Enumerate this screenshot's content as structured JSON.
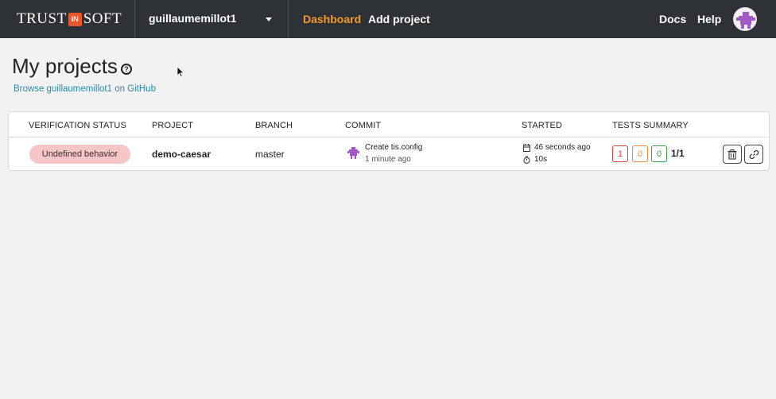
{
  "header": {
    "logo_left": "TRUST",
    "logo_mid": "IN",
    "logo_right": "SOFT",
    "user": "guillaumemillot1",
    "nav": [
      {
        "label": "Dashboard"
      },
      {
        "label": "Add project"
      }
    ],
    "docs": "Docs",
    "help": "Help"
  },
  "page": {
    "title": "My projects",
    "help_glyph": "?",
    "github_link": "Browse guillaumemillot1 on GitHub"
  },
  "table": {
    "columns": [
      "VERIFICATION STATUS",
      "PROJECT",
      "BRANCH",
      "COMMIT",
      "STARTED",
      "TESTS SUMMARY"
    ],
    "rows": [
      {
        "status": "Undefined behavior",
        "project": "demo-caesar",
        "branch": "master",
        "commit_message": "Create tis.config",
        "commit_time": "1 minute ago",
        "started": "46 seconds ago",
        "duration": "10s",
        "tests": {
          "failed": "1",
          "warning": "0",
          "passed": "0",
          "ratio": "1/1"
        }
      }
    ]
  },
  "colors": {
    "topbar": "#2e3136",
    "accent": "#f39a2c",
    "link": "#2a8ba9",
    "status_pill": "#f6c5c5",
    "avatar_purple": "#a25ac7"
  },
  "icons": [
    "caret-down-icon",
    "question-circle-icon",
    "identicon-avatar",
    "calendar-icon",
    "stopwatch-icon",
    "trash-icon",
    "link-icon",
    "mouse-cursor-icon"
  ]
}
